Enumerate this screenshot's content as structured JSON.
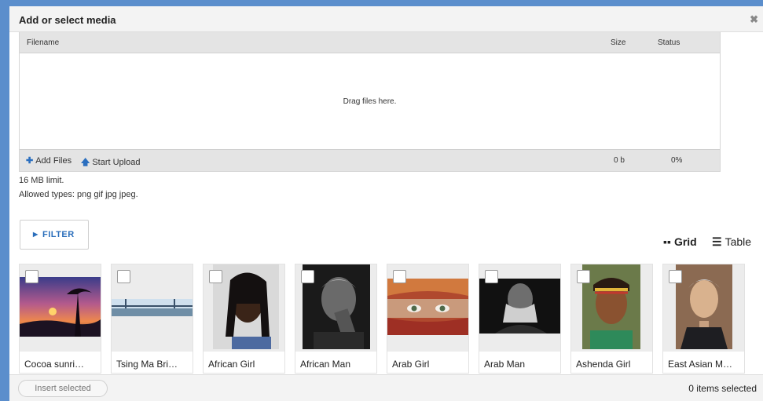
{
  "dialog": {
    "title": "Add or select media",
    "close_icon": "close-icon",
    "close_glyph": "✖"
  },
  "uploader": {
    "col_filename": "Filename",
    "col_size": "Size",
    "col_status": "Status",
    "drop_text": "Drag files here.",
    "add_files": "Add Files",
    "start_upload": "Start Upload",
    "total_size": "0 b",
    "total_status": "0%",
    "add_icon": "plus-icon",
    "upload_icon": "arrow-up-icon"
  },
  "limits": {
    "size_limit": "16 MB limit.",
    "allowed_types": "Allowed types: png gif jpg jpeg."
  },
  "filter": {
    "label": "FILTER",
    "icon": "triangle-right-icon"
  },
  "view_toggle": {
    "grid_label": "Grid",
    "table_label": "Table",
    "active": "grid"
  },
  "media": [
    {
      "name": "Cocoa sunri…",
      "checked": false
    },
    {
      "name": "Tsing Ma Bri…",
      "checked": false
    },
    {
      "name": "African Girl",
      "checked": false
    },
    {
      "name": "African Man",
      "checked": false
    },
    {
      "name": "Arab Girl",
      "checked": false
    },
    {
      "name": "Arab Man",
      "checked": false
    },
    {
      "name": "Ashenda Girl",
      "checked": false
    },
    {
      "name": "East Asian M…",
      "checked": false
    }
  ],
  "footer": {
    "insert_label": "Insert selected",
    "selection_count": "0 items selected"
  },
  "colors": {
    "accent": "#2a6ebb",
    "frame_border": "#5b8ecc",
    "header_bg": "#e4e4e4"
  }
}
